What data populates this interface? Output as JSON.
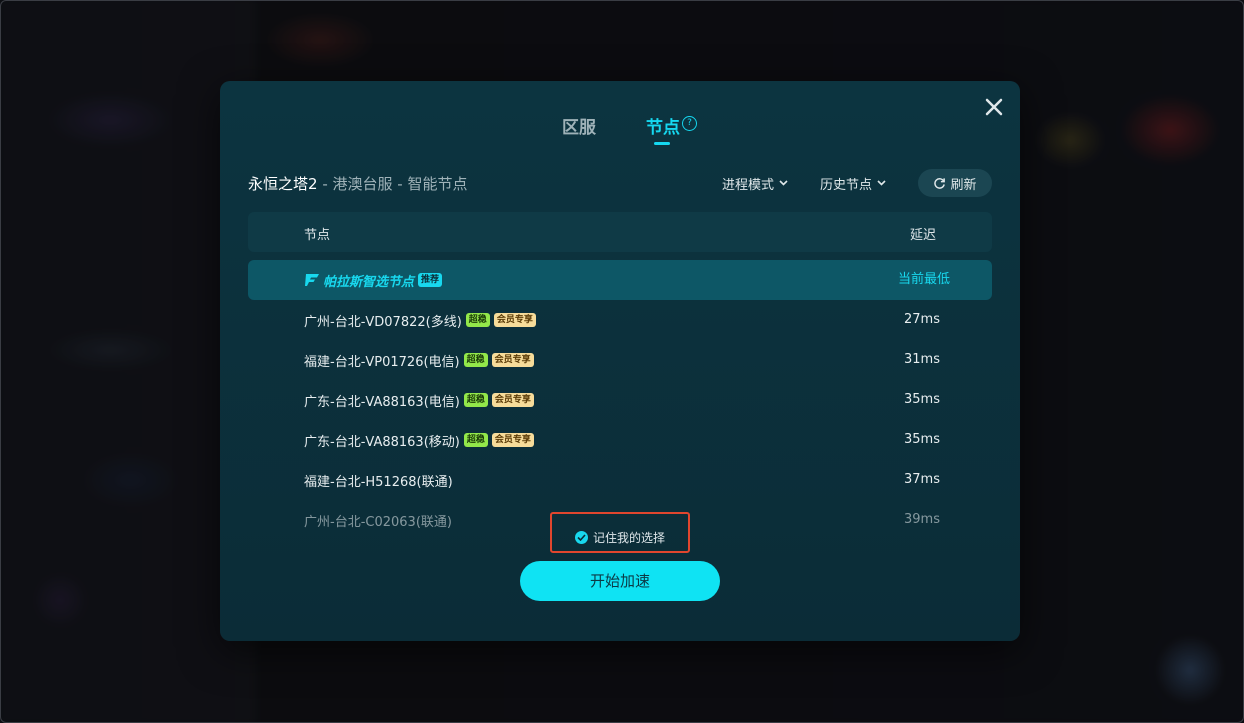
{
  "dialog": {
    "tabs": [
      {
        "label": "区服"
      },
      {
        "label": "节点"
      }
    ],
    "help_icon": "?",
    "game_name": "永恒之塔2",
    "separator": " - ",
    "region": "港澳台服",
    "mode": "智能节点",
    "process_mode_label": "进程模式",
    "history_nodes_label": "历史节点",
    "refresh_label": "刷新",
    "table_header": {
      "node": "节点",
      "latency": "延迟"
    },
    "rows": [
      {
        "name": "帕拉斯智选节点",
        "badges": [
          "推荐"
        ],
        "latency": "当前最低",
        "selected": true
      },
      {
        "name": "广州-台北-VD07822(多线)",
        "badges": [
          "超稳",
          "会员专享"
        ],
        "latency": "27ms"
      },
      {
        "name": "福建-台北-VP01726(电信)",
        "badges": [
          "超稳",
          "会员专享"
        ],
        "latency": "31ms"
      },
      {
        "name": "广东-台北-VA88163(电信)",
        "badges": [
          "超稳",
          "会员专享"
        ],
        "latency": "35ms"
      },
      {
        "name": "广东-台北-VA88163(移动)",
        "badges": [
          "超稳",
          "会员专享"
        ],
        "latency": "35ms"
      },
      {
        "name": "福建-台北-H51268(联通)",
        "badges": [],
        "latency": "37ms"
      },
      {
        "name": "广州-台北-C02063(联通)",
        "badges": [],
        "latency": "39ms",
        "faded": true
      }
    ],
    "remember_label": "记住我的选择",
    "start_label": "开始加速"
  },
  "colors": {
    "accent": "#15d8f0",
    "dialog_bg": "#0c3440",
    "highlight": "#e0462e",
    "badge_fast": "#93e84a",
    "badge_vip": "#f7dc9a"
  },
  "icons": {
    "close": "close-icon",
    "help": "help-icon",
    "chevron": "chevron-down-icon",
    "refresh": "refresh-icon",
    "brand": "brand-icon",
    "check": "check-circle-icon"
  }
}
